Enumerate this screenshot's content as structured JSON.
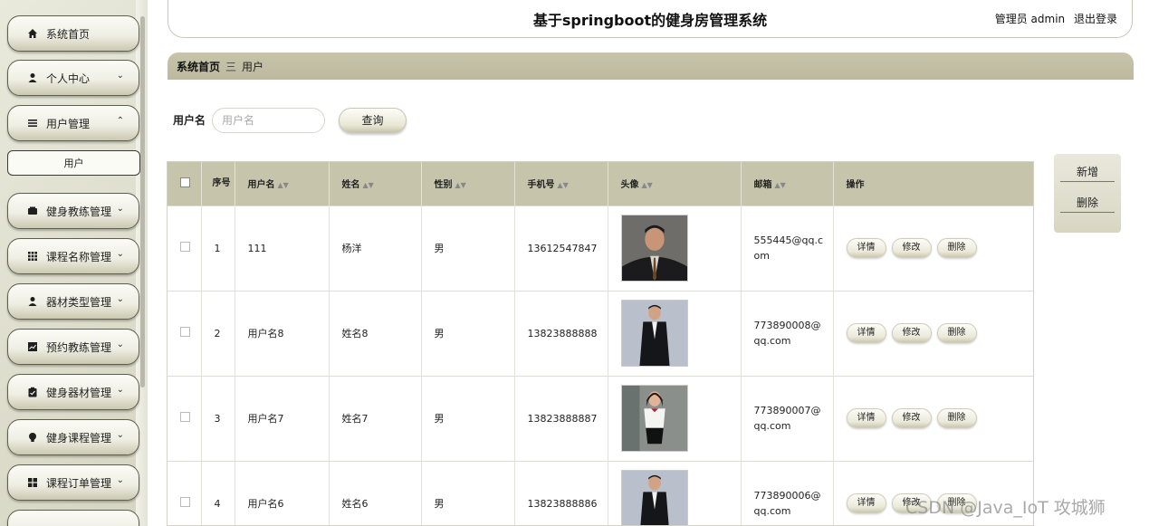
{
  "header": {
    "title": "基于springboot的健身房管理系统",
    "user_label": "管理员 admin",
    "logout_label": "退出登录"
  },
  "sidebar": {
    "items": [
      {
        "label": "系统首页",
        "icon": "home-icon"
      },
      {
        "label": "个人中心",
        "icon": "person-icon"
      },
      {
        "label": "用户管理",
        "icon": "list-icon"
      },
      {
        "label": "健身教练管理",
        "icon": "wallet-icon"
      },
      {
        "label": "课程名称管理",
        "icon": "grid-icon"
      },
      {
        "label": "器材类型管理",
        "icon": "person-icon"
      },
      {
        "label": "预约教练管理",
        "icon": "chart-icon"
      },
      {
        "label": "健身器材管理",
        "icon": "clipboard-icon"
      },
      {
        "label": "健身课程管理",
        "icon": "bulb-icon"
      },
      {
        "label": "课程订单管理",
        "icon": "apps-icon"
      }
    ],
    "sub_item": "用户"
  },
  "breadcrumb": {
    "home": "系统首页",
    "separator": "三",
    "current": "用户"
  },
  "search": {
    "label": "用户名",
    "placeholder": "用户名",
    "button": "查询"
  },
  "table": {
    "headers": [
      "序号",
      "用户名",
      "姓名",
      "性别",
      "手机号",
      "头像",
      "邮箱",
      "操作"
    ],
    "rows": [
      {
        "index": "1",
        "username": "111",
        "name": "杨洋",
        "gender": "男",
        "phone": "13612547847",
        "email": "555445@qq.com"
      },
      {
        "index": "2",
        "username": "用户名8",
        "name": "姓名8",
        "gender": "男",
        "phone": "13823888888",
        "email": "773890008@qq.com"
      },
      {
        "index": "3",
        "username": "用户名7",
        "name": "姓名7",
        "gender": "男",
        "phone": "13823888887",
        "email": "773890007@qq.com"
      },
      {
        "index": "4",
        "username": "用户名6",
        "name": "姓名6",
        "gender": "男",
        "phone": "13823888886",
        "email": "773890006@qq.com"
      }
    ],
    "actions": {
      "detail": "详情",
      "edit": "修改",
      "delete": "删除"
    }
  },
  "side_actions": {
    "add": "新增",
    "delete": "删除"
  },
  "watermark": "CSDN @Java_IoT 攻城狮",
  "colors": {
    "accent": "#c6c4ab",
    "sidebar_bg": "#e2e1d1"
  }
}
